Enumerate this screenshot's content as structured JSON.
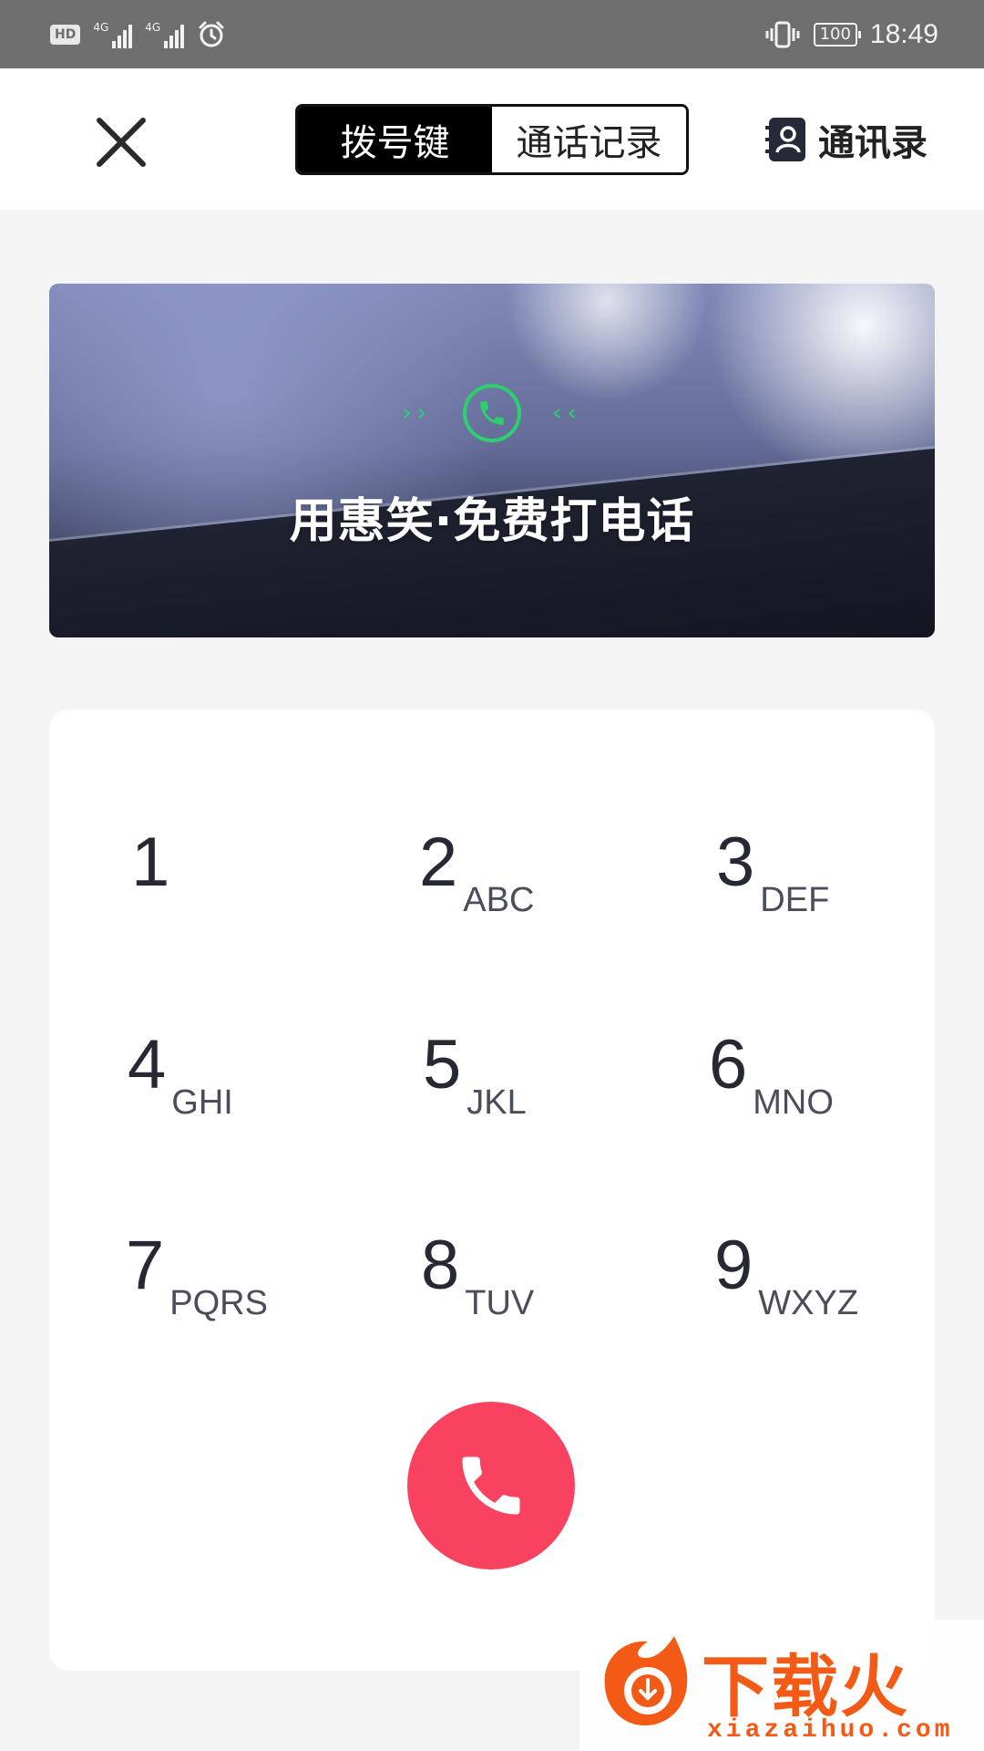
{
  "status_bar": {
    "hd": "HD",
    "signal1": "4G",
    "signal2": "4G",
    "battery": "100",
    "time": "18:49"
  },
  "nav": {
    "tab_dialpad": "拨号键",
    "tab_history": "通话记录",
    "contacts": "通讯录",
    "active_tab": "拨号键"
  },
  "banner": {
    "title": "用惠笑·免费打电话",
    "accent_color": "#2ed06e"
  },
  "dialpad": {
    "keys": [
      {
        "digit": "1",
        "letters": ""
      },
      {
        "digit": "2",
        "letters": "ABC"
      },
      {
        "digit": "3",
        "letters": "DEF"
      },
      {
        "digit": "4",
        "letters": "GHI"
      },
      {
        "digit": "5",
        "letters": "JKL"
      },
      {
        "digit": "6",
        "letters": "MNO"
      },
      {
        "digit": "7",
        "letters": "PQRS"
      },
      {
        "digit": "8",
        "letters": "TUV"
      },
      {
        "digit": "9",
        "letters": "WXYZ"
      }
    ],
    "call_color": "#f9425f"
  },
  "watermark": {
    "text": "下载火",
    "sub": "xiazaihuo.com"
  },
  "icons": {
    "close": "close-icon",
    "contacts": "contacts-book-icon",
    "banner_phone": "phone-icon",
    "call": "phone-icon"
  }
}
